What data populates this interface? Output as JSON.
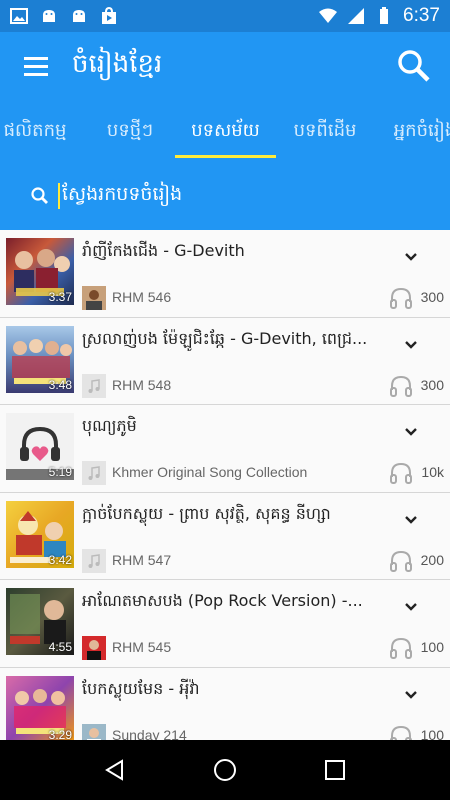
{
  "status_bar": {
    "time": "6:37"
  },
  "app_bar": {
    "title": "ចំរៀងខ្មែរ"
  },
  "tabs": [
    {
      "label": "ផលិតកម្ម"
    },
    {
      "label": "បទថ្មីៗ"
    },
    {
      "label": "បទសម័យ"
    },
    {
      "label": "បទពីដើម"
    },
    {
      "label": "អ្នកចំរៀង"
    }
  ],
  "search": {
    "placeholder": "ស្វែងរកបទចំរៀង"
  },
  "songs": [
    {
      "title": "រាំញីកែងជើង - G-Devith",
      "duration": "3:37",
      "artist": "RHM 546",
      "plays": "300"
    },
    {
      "title": "ស្រលាញ់បង ម៉ែឡូជិះឆ្កែ - G-Devith, ពេជ្រ...",
      "duration": "3:48",
      "artist": "RHM 548",
      "plays": "300"
    },
    {
      "title": "បុណ្យភូមិ",
      "duration": "5:19",
      "artist": "Khmer Original Song Collection",
      "plays": "10k"
    },
    {
      "title": "ក្អាច់បែកស្លុយ - ព្រាប សុវត្ថិ, សុគន្ធ នីហ្សា",
      "duration": "3:42",
      "artist": "RHM 547",
      "plays": "200"
    },
    {
      "title": "អាណែតមាសបង (Pop Rock Version) -...",
      "duration": "4:55",
      "artist": "RHM 545",
      "plays": "100"
    },
    {
      "title": "បែកស្លុយមែន - អុីវ៉ា",
      "duration": "3:29",
      "artist": "Sunday 214",
      "plays": "100"
    }
  ],
  "colors": {
    "primary": "#2196f3",
    "status": "#1c7fd3",
    "indicator": "#ffeb3b"
  }
}
